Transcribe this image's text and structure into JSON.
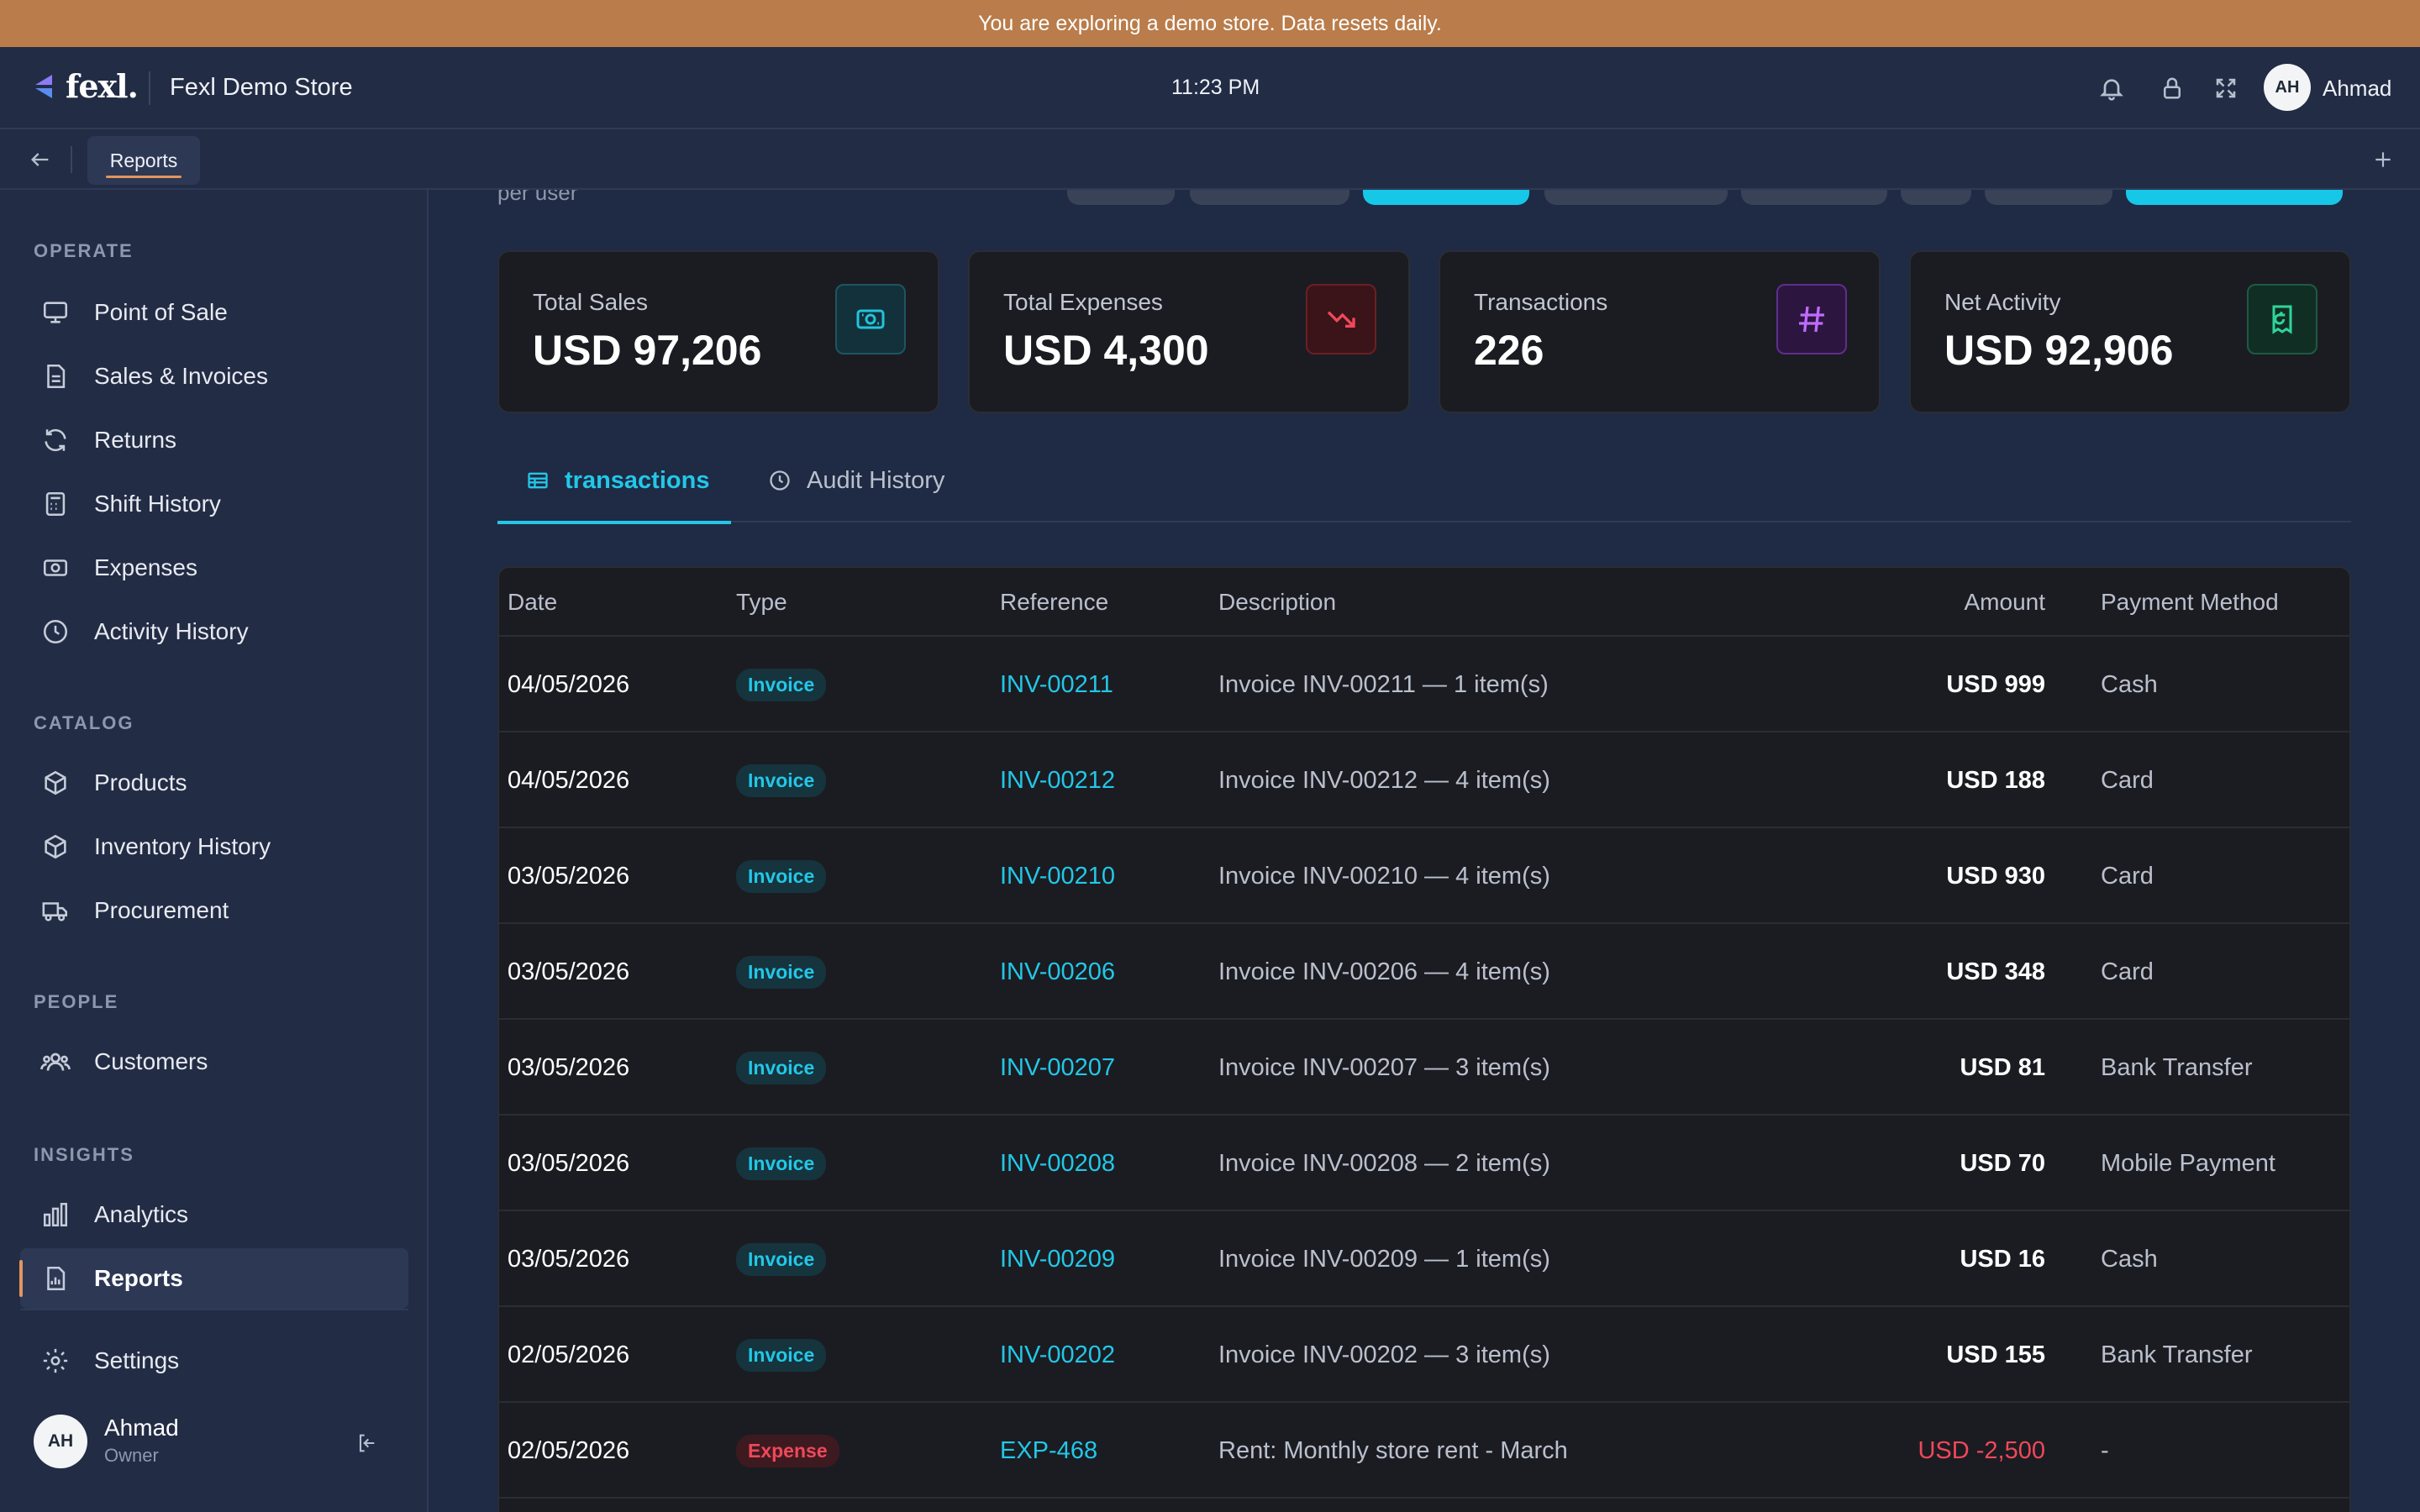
{
  "banner": {
    "text": "You are exploring a demo store. Data resets daily."
  },
  "header": {
    "logo_text": "fexl.",
    "store_name": "Fexl Demo Store",
    "time": "11:23 PM",
    "user_initials": "AH",
    "user_name": "Ahmad",
    "icons": [
      "bell-icon",
      "lock-icon",
      "fullscreen-icon"
    ]
  },
  "tabbar": {
    "active_tab": "Reports"
  },
  "sidebar": {
    "sections": {
      "operate": "OPERATE",
      "catalog": "CATALOG",
      "people": "PEOPLE",
      "insights": "INSIGHTS"
    },
    "items": {
      "pos": "Point of Sale",
      "sales": "Sales & Invoices",
      "returns": "Returns",
      "shift": "Shift History",
      "expenses": "Expenses",
      "activity": "Activity History",
      "products": "Products",
      "inventory": "Inventory History",
      "procurement": "Procurement",
      "customers": "Customers",
      "analytics": "Analytics",
      "reports": "Reports",
      "settings": "Settings"
    },
    "user": {
      "initials": "AH",
      "name": "Ahmad",
      "role": "Owner"
    }
  },
  "main": {
    "partial_text": "per user",
    "stats": [
      {
        "title": "Total Sales",
        "value": "USD 97,206",
        "icon": "cash-icon",
        "accent": "#22c3dc"
      },
      {
        "title": "Total Expenses",
        "value": "USD 4,300",
        "icon": "trending-down-icon",
        "accent": "#f0485a"
      },
      {
        "title": "Transactions",
        "value": "226",
        "icon": "hash-icon",
        "accent": "#c06bff"
      },
      {
        "title": "Net Activity",
        "value": "USD 92,906",
        "icon": "receipt-return-icon",
        "accent": "#2ed59a"
      }
    ],
    "tabs": {
      "transactions": "transactions",
      "audit": "Audit History"
    },
    "table": {
      "columns": {
        "date": "Date",
        "type": "Type",
        "reference": "Reference",
        "description": "Description",
        "amount": "Amount",
        "method": "Payment Method"
      },
      "rows": [
        {
          "date": "04/05/2026",
          "type": "Invoice",
          "ref": "INV-00211",
          "desc": "Invoice INV-00211 — 1 item(s)",
          "amount": "USD 999",
          "method": "Cash"
        },
        {
          "date": "04/05/2026",
          "type": "Invoice",
          "ref": "INV-00212",
          "desc": "Invoice INV-00212 — 4 item(s)",
          "amount": "USD 188",
          "method": "Card"
        },
        {
          "date": "03/05/2026",
          "type": "Invoice",
          "ref": "INV-00210",
          "desc": "Invoice INV-00210 — 4 item(s)",
          "amount": "USD 930",
          "method": "Card"
        },
        {
          "date": "03/05/2026",
          "type": "Invoice",
          "ref": "INV-00206",
          "desc": "Invoice INV-00206 — 4 item(s)",
          "amount": "USD 348",
          "method": "Card"
        },
        {
          "date": "03/05/2026",
          "type": "Invoice",
          "ref": "INV-00207",
          "desc": "Invoice INV-00207 — 3 item(s)",
          "amount": "USD 81",
          "method": "Bank Transfer"
        },
        {
          "date": "03/05/2026",
          "type": "Invoice",
          "ref": "INV-00208",
          "desc": "Invoice INV-00208 — 2 item(s)",
          "amount": "USD 70",
          "method": "Mobile Payment"
        },
        {
          "date": "03/05/2026",
          "type": "Invoice",
          "ref": "INV-00209",
          "desc": "Invoice INV-00209 — 1 item(s)",
          "amount": "USD 16",
          "method": "Cash"
        },
        {
          "date": "02/05/2026",
          "type": "Invoice",
          "ref": "INV-00202",
          "desc": "Invoice INV-00202 — 3 item(s)",
          "amount": "USD 155",
          "method": "Bank Transfer"
        },
        {
          "date": "02/05/2026",
          "type": "Expense",
          "ref": "EXP-468",
          "desc": "Rent: Monthly store rent - March",
          "amount": "USD -2,500",
          "method": "-"
        }
      ]
    }
  },
  "colors": {
    "accent_cyan": "#22c7e8",
    "accent_orange": "#e2955e",
    "negative_red": "#f0485a",
    "banner": "#b97c4a"
  }
}
